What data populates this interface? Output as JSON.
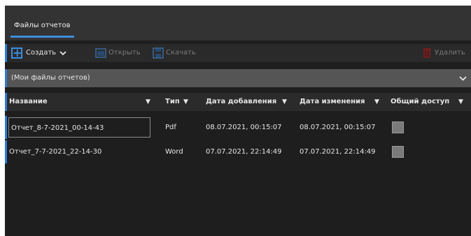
{
  "tab": {
    "label": "Файлы отчетов"
  },
  "toolbar": {
    "create_label": "Создать",
    "open_label": "Открыть",
    "download_label": "Скачать",
    "delete_label": "Удалить"
  },
  "filter": {
    "selected": "(Мои файлы отчетов)"
  },
  "table": {
    "headers": {
      "name": "Название",
      "type": "Тип",
      "date_added": "Дата добавления",
      "date_modified": "Дата изменения",
      "shared": "Общий доступ"
    },
    "rows": [
      {
        "name": "Отчет_8-7-2021_00-14-43",
        "type": "Pdf",
        "date_added": "08.07.2021, 00:15:07",
        "date_modified": "08.07.2021, 00:15:07",
        "shared": false
      },
      {
        "name": "Отчет_7-7-2021_22-14-30",
        "type": "Word",
        "date_added": "07.07.2021, 22:14:49",
        "date_modified": "07.07.2021, 22:14:49",
        "shared": false
      }
    ]
  },
  "colors": {
    "accent": "#3d8fe0",
    "background": "#1e1e1e",
    "disabled": "#7a7a7a",
    "delete_icon": "#8b2a2a"
  },
  "icons": [
    "plus-icon",
    "open-icon",
    "download-icon",
    "trash-icon",
    "chevron-down-icon",
    "filter-icon"
  ]
}
